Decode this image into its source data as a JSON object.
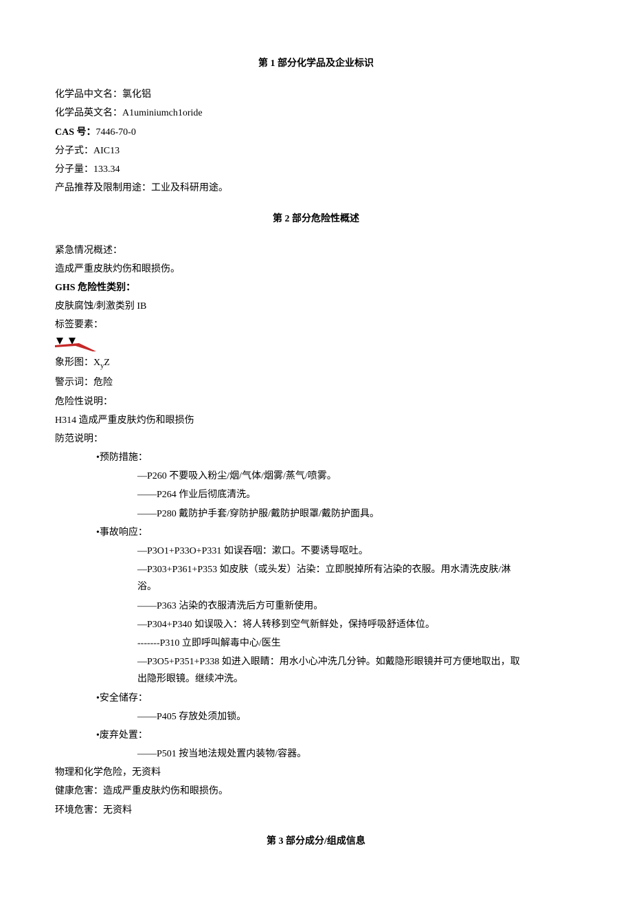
{
  "section1": {
    "title": "第 1 部分化学品及企业标识",
    "name_cn_label": "化学品中文名：",
    "name_cn": "氯化铝",
    "name_en_label": "化学品英文名：",
    "name_en": "A1uminiumch1oride",
    "cas_label": "CAS 号：",
    "cas": "7446-70-0",
    "formula_label": "分子式：",
    "formula": "AIC13",
    "mw_label": "分子量：",
    "mw": "133.34",
    "use_label": "产品推荐及限制用途：",
    "use": "工业及科研用途。"
  },
  "section2": {
    "title": "第 2 部分危险性概述",
    "emergency_label": "紧急情况概述：",
    "emergency_text": "造成严重皮肤灼伤和眼损伤。",
    "ghs_label": "GHS 危险性类别：",
    "ghs_text": "皮肤腐蚀/刺激类别 IB",
    "label_elements_label": "标签要素：",
    "pictogram_label": "象形图：",
    "pictogram_value": "XyZ",
    "signal_label": "警示词：",
    "signal_value": "危险",
    "hazard_statement_label": "危险性说明：",
    "hazard_statement": "H314 造成严重皮肤灼伤和眼损伤",
    "precaution_label": "防范说明：",
    "prevention_label": "•预防措施：",
    "prevention_items": [
      "—P260 不要吸入粉尘/烟/气体/烟雾/蒸气/喷雾。",
      "——P264 作业后彻底清洗。",
      "——P280 戴防护手套/穿防护服/戴防护眼罩/戴防护面具。"
    ],
    "response_label": "•事故响应：",
    "response_items": [
      "—P3O1+P33O+P331 如误吞咽：漱口。不要诱导呕吐。",
      "—P303+P361+P353 如皮肤（或头发）沾染：立即脱掉所有沾染的衣服。用水清洗皮肤/淋浴。",
      "——P363 沾染的衣服清洗后方可重新使用。",
      "—P304+P340 如误吸入：将人转移到空气新鲜处，保持呼吸舒适体位。",
      "-------P310 立即呼叫解毒中心/医生",
      "—P3O5+P351+P338 如进入眼睛：用水小心冲洗几分钟。如戴隐形眼镜并可方便地取出，取出隐形眼镜。继续冲洗。"
    ],
    "storage_label": "•安全储存：",
    "storage_items": [
      "——P405 存放处须加锁。"
    ],
    "disposal_label": "•废弃处置：",
    "disposal_items": [
      "——P501 按当地法规处置内装物/容器。"
    ],
    "phys_chem_label": "物理和化学危险，",
    "phys_chem_value": "无资料",
    "health_label": "健康危害：",
    "health_value": "造成严重皮肤灼伤和眼损伤。",
    "env_label": "环境危害：",
    "env_value": "无资料"
  },
  "section3": {
    "title": "第 3 部分成分/组成信息"
  }
}
